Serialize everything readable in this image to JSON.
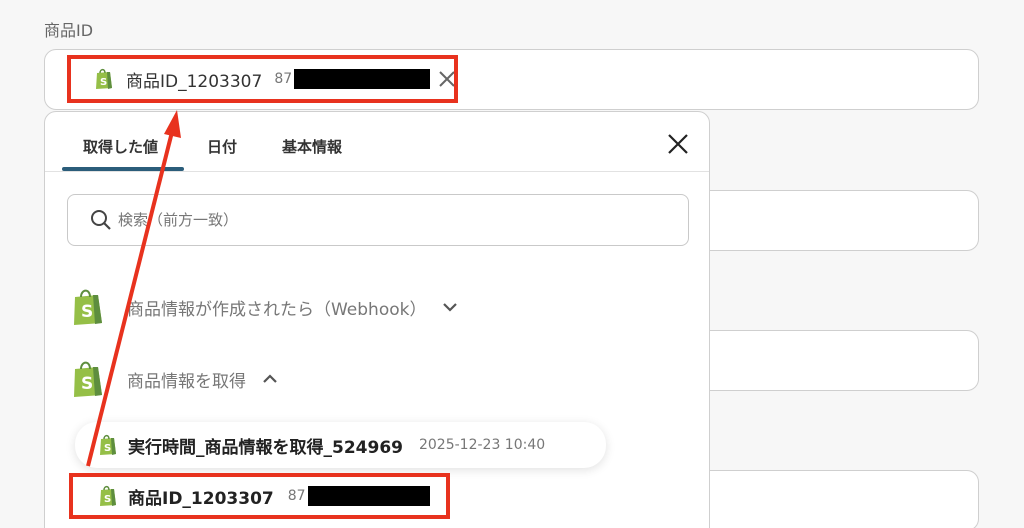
{
  "field": {
    "label": "商品ID"
  },
  "selected_chip": {
    "icon": "shopify-bag-icon",
    "name": "商品ID_1203307",
    "value_prefix": "87"
  },
  "panel": {
    "tabs": [
      {
        "label": "取得した値",
        "active": true
      },
      {
        "label": "日付",
        "active": false
      },
      {
        "label": "基本情報",
        "active": false
      }
    ],
    "search": {
      "placeholder": "検索（前方一致）"
    },
    "groups": [
      {
        "label": "商品情報が作成されたら（Webhook）",
        "expanded": false
      },
      {
        "label": "商品情報を取得",
        "expanded": true
      }
    ],
    "items": [
      {
        "name": "実行時間_商品情報を取得_524969",
        "value": "2025-12-23 10:40"
      },
      {
        "name": "商品ID_1203307",
        "value_prefix": "87"
      }
    ]
  },
  "colors": {
    "highlight_red": "#e8321e",
    "active_tab": "#2b5d7a",
    "shopify_green": "#95bf47"
  }
}
